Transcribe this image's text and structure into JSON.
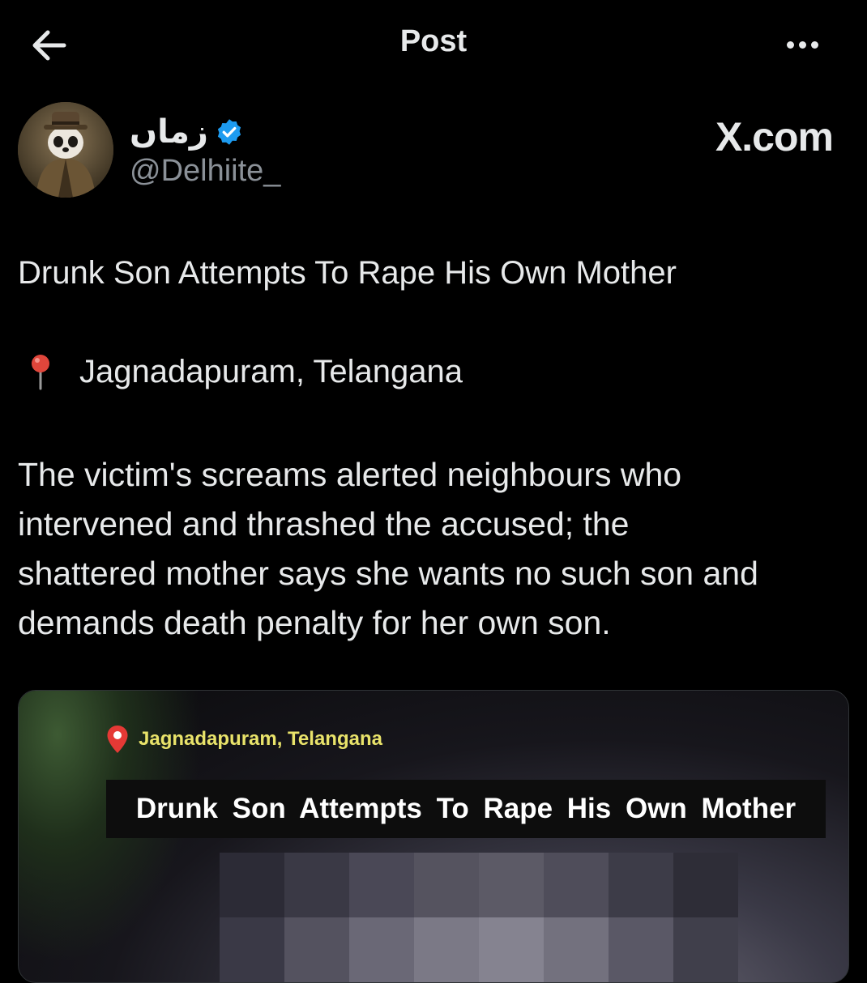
{
  "header": {
    "title": "Post"
  },
  "author": {
    "display_name": "زماں",
    "handle": "@Delhiite_",
    "verified_color": "#1d9bf0"
  },
  "watermark": "X.com",
  "post": {
    "headline": "Drunk Son Attempts To Rape His Own Mother",
    "location": "Jagnadapuram, Telangana",
    "paragraph_lines": [
      "The victim's screams alerted neighbours who",
      "intervened and thrashed the accused; the",
      "shattered mother says she wants no such son and",
      "demands death penalty for her own son."
    ]
  },
  "media": {
    "location": "Jagnadapuram, Telangana",
    "title": "Drunk Son Attempts To Rape His Own Mother"
  },
  "icons": {
    "back": "arrow-left-icon",
    "more": "more-horizontal-icon",
    "verified": "verified-badge-icon",
    "location": "round-pushpin-icon",
    "media_location": "map-pin-icon"
  }
}
